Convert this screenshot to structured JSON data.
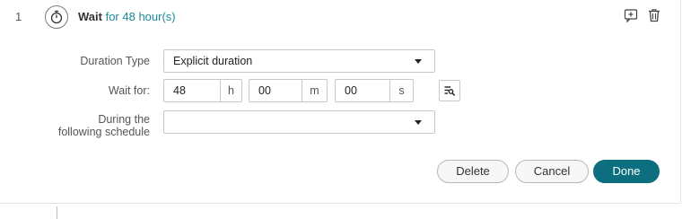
{
  "step": {
    "number": "1",
    "icon": "stopwatch-icon",
    "title": "Wait",
    "detail": "for 48 hour(s)",
    "actions": {
      "add_icon": "add-comment-icon",
      "delete_icon": "trash-icon"
    }
  },
  "form": {
    "duration_type": {
      "label": "Duration Type",
      "value": "Explicit duration"
    },
    "wait_for": {
      "label": "Wait for:",
      "hours": "48",
      "hours_unit": "h",
      "minutes": "00",
      "minutes_unit": "m",
      "seconds": "00",
      "seconds_unit": "s",
      "picker_icon": "expression-picker-icon"
    },
    "schedule": {
      "label_line1": "During the",
      "label_line2": "following schedule",
      "value": ""
    }
  },
  "buttons": {
    "delete": "Delete",
    "cancel": "Cancel",
    "done": "Done"
  },
  "colors": {
    "accent": "#0c6e7e",
    "link": "#1a8a9a"
  }
}
